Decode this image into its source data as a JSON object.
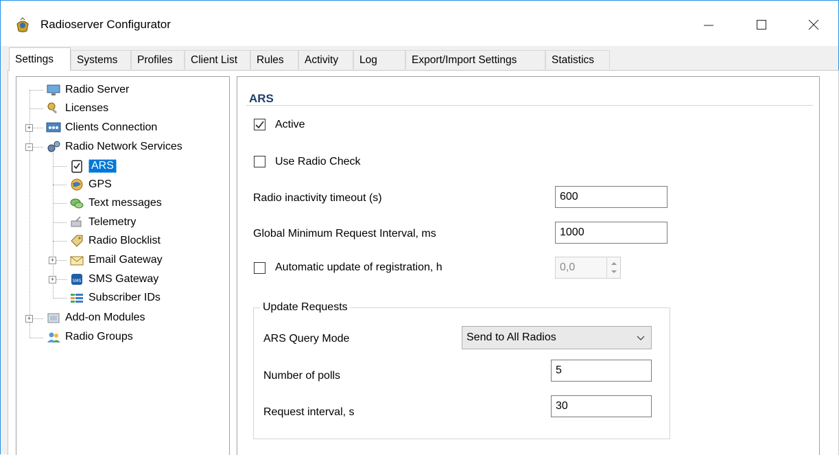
{
  "window": {
    "title": "Radioserver Configurator"
  },
  "tabs": [
    {
      "label": "Settings"
    },
    {
      "label": "Systems"
    },
    {
      "label": "Profiles"
    },
    {
      "label": "Client List"
    },
    {
      "label": "Rules"
    },
    {
      "label": "Activity"
    },
    {
      "label": "Log"
    },
    {
      "label": "Export/Import Settings"
    },
    {
      "label": "Statistics"
    }
  ],
  "tree": {
    "items": [
      {
        "label": "Radio Server",
        "icon": "monitor-icon"
      },
      {
        "label": "Licenses",
        "icon": "key-icon"
      },
      {
        "label": "Clients Connection",
        "icon": "network-icon"
      },
      {
        "label": "Radio Network Services",
        "icon": "gears-icon"
      },
      {
        "label": "ARS",
        "icon": "clipboard-check-icon"
      },
      {
        "label": "GPS",
        "icon": "globe-icon"
      },
      {
        "label": "Text messages",
        "icon": "chat-icon"
      },
      {
        "label": "Telemetry",
        "icon": "telemetry-icon"
      },
      {
        "label": "Radio Blocklist",
        "icon": "tag-icon"
      },
      {
        "label": "Email Gateway",
        "icon": "envelope-icon"
      },
      {
        "label": "SMS Gateway",
        "icon": "sms-icon"
      },
      {
        "label": "Subscriber IDs",
        "icon": "list-icon"
      },
      {
        "label": "Add-on Modules",
        "icon": "modules-icon"
      },
      {
        "label": "Radio Groups",
        "icon": "users-icon"
      }
    ]
  },
  "ars": {
    "title": "ARS",
    "active_label": "Active",
    "active_checked": true,
    "use_radio_check_label": "Use Radio Check",
    "use_radio_check_checked": false,
    "radio_inactivity_label": "Radio inactivity timeout (s)",
    "radio_inactivity_value": "600",
    "global_min_label": "Global Minimum Request Interval, ms",
    "global_min_value": "1000",
    "auto_update_label": "Automatic update of registration, h",
    "auto_update_checked": false,
    "auto_update_value": "0,0",
    "update_requests": {
      "group_title": "Update Requests",
      "query_mode_label": "ARS Query Mode",
      "query_mode_value": "Send to All Radios",
      "polls_label": "Number of polls",
      "polls_value": "5",
      "interval_label": "Request interval, s",
      "interval_value": "30"
    }
  },
  "colors": {
    "accent": "#0078d7",
    "section_title": "#1f3f6b",
    "window_border": "#1e90e8"
  }
}
